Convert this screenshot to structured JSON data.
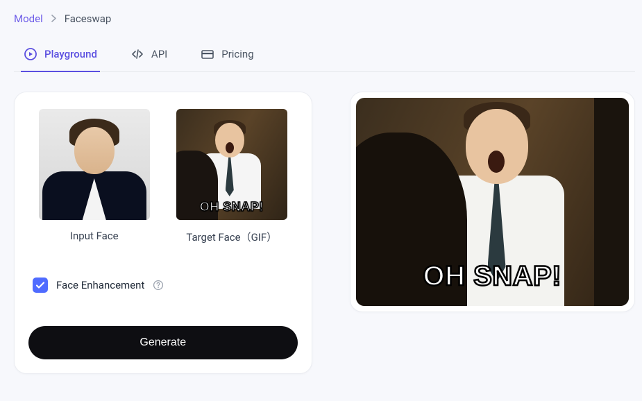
{
  "breadcrumb": {
    "root": "Model",
    "current": "Faceswap"
  },
  "tabs": {
    "playground": "Playground",
    "api": "API",
    "pricing": "Pricing"
  },
  "inputs": {
    "input_face_label": "Input Face",
    "target_face_label": "Target Face（GIF）",
    "target_caption": "OH SNAP!"
  },
  "options": {
    "face_enhancement_label": "Face Enhancement",
    "face_enhancement_checked": true
  },
  "actions": {
    "generate": "Generate"
  },
  "output": {
    "caption": "OH SNAP!"
  }
}
